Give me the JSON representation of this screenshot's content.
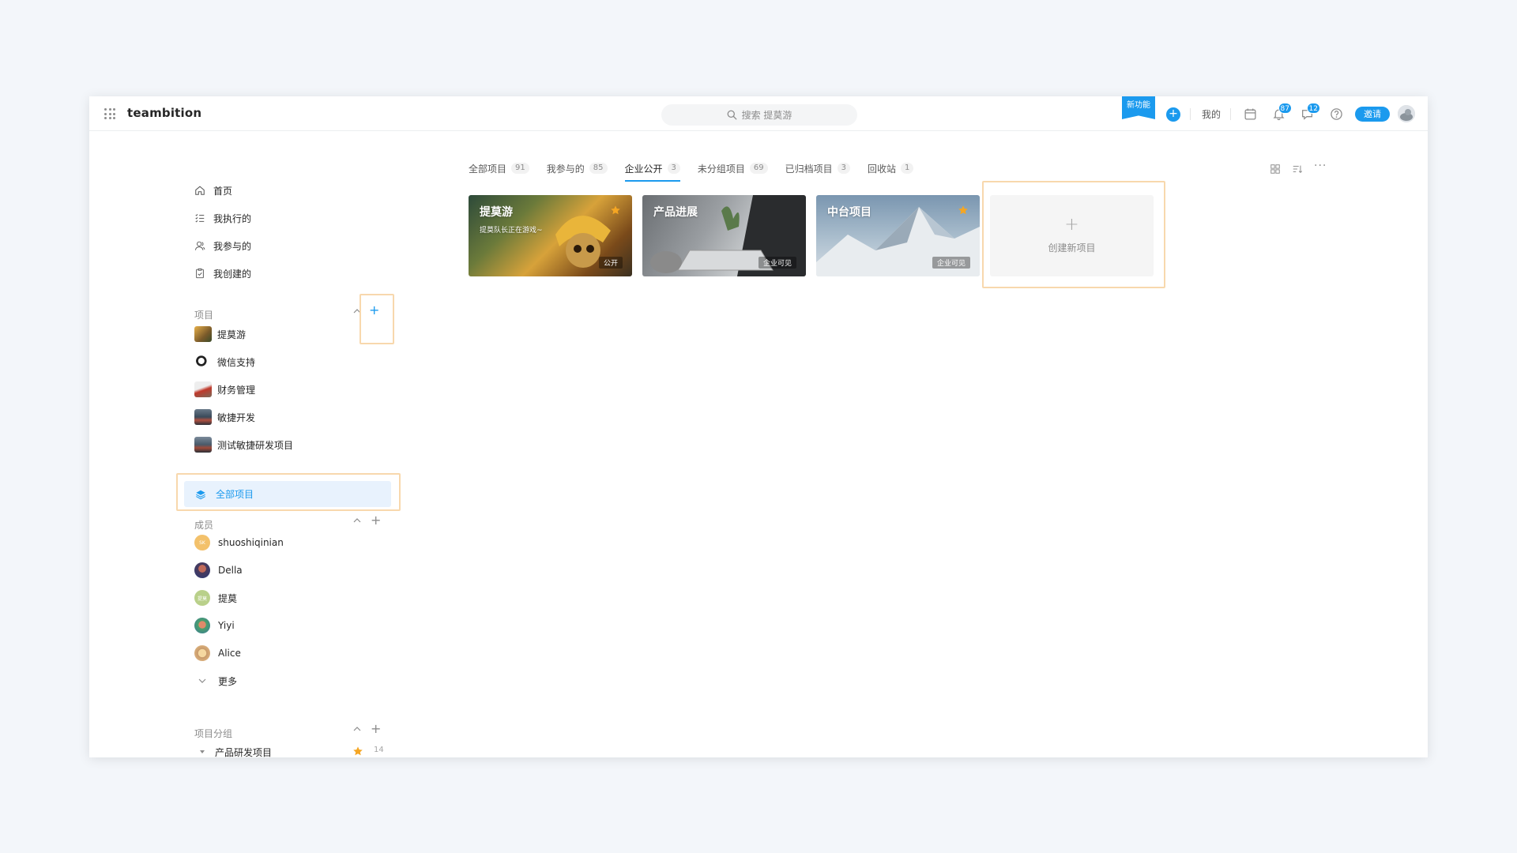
{
  "app": {
    "brand": "teambition"
  },
  "search": {
    "placeholder": "搜索 提莫游"
  },
  "topbar": {
    "new_feature": "新功能",
    "add": "+",
    "mine": "我的",
    "notify_count": "87",
    "message_count": "12",
    "invite": "邀请"
  },
  "nav": {
    "home": "首页",
    "executing": "我执行的",
    "participating": "我参与的",
    "created": "我创建的"
  },
  "projects_section": {
    "title": "项目",
    "items": [
      {
        "label": "提莫游"
      },
      {
        "label": "微信支持"
      },
      {
        "label": "财务管理"
      },
      {
        "label": "敏捷开发"
      },
      {
        "label": "测试敏捷研发项目"
      }
    ],
    "all_label": "全部项目"
  },
  "members_section": {
    "title": "成员",
    "items": [
      {
        "name": "shuoshiqinian",
        "initials": "SK"
      },
      {
        "name": "Della",
        "initials": ""
      },
      {
        "name": "提莫",
        "initials": "提莫"
      },
      {
        "name": "Yiyi",
        "initials": ""
      },
      {
        "name": "Alice",
        "initials": ""
      }
    ],
    "more": "更多"
  },
  "groups_section": {
    "title": "项目分组",
    "items": [
      {
        "label": "产品研发项目",
        "count": "14"
      }
    ]
  },
  "tabs": [
    {
      "label": "全部项目",
      "count": "91"
    },
    {
      "label": "我参与的",
      "count": "85"
    },
    {
      "label": "企业公开",
      "count": "3",
      "active": true
    },
    {
      "label": "未分组项目",
      "count": "69"
    },
    {
      "label": "已归档项目",
      "count": "3"
    },
    {
      "label": "回收站",
      "count": "1"
    }
  ],
  "cards": [
    {
      "title": "提莫游",
      "subtitle": "提莫队长正在游戏~",
      "visibility": "公开",
      "starred": true
    },
    {
      "title": "产品进展",
      "subtitle": "",
      "visibility": "企业可见",
      "starred": false
    },
    {
      "title": "中台项目",
      "subtitle": "",
      "visibility": "企业可见",
      "starred": true
    }
  ],
  "new_project": {
    "label": "创建新项目",
    "plus": "+"
  },
  "colors": {
    "accent": "#1b9aee",
    "highlight": "#f8d8ad",
    "star": "#f5a623"
  }
}
